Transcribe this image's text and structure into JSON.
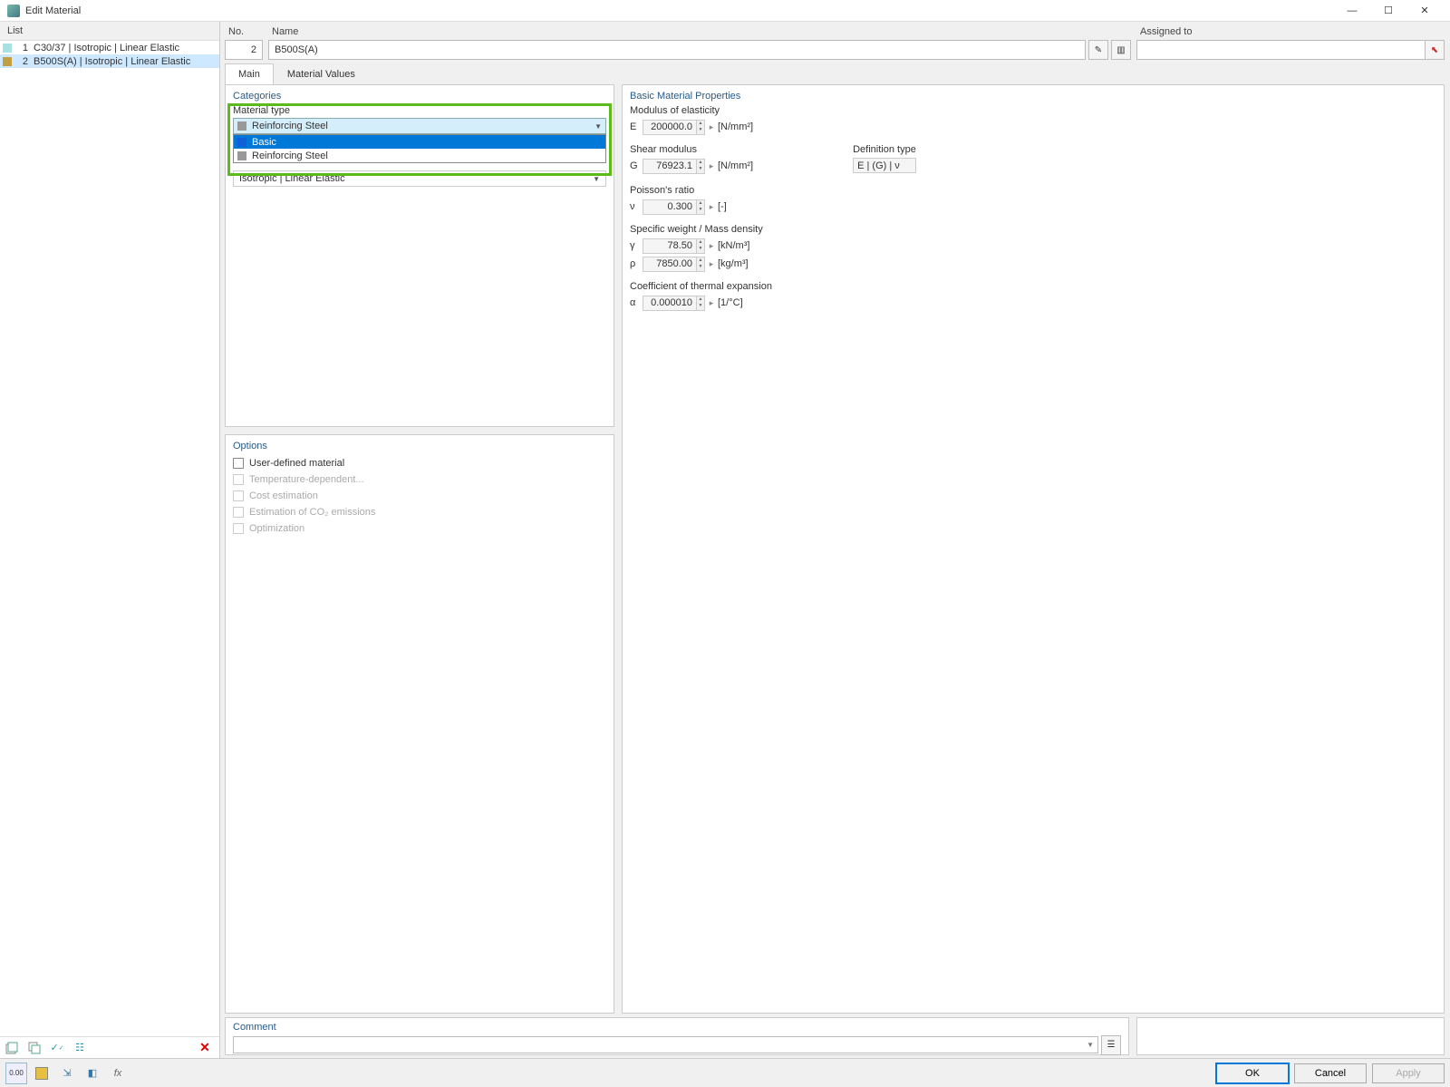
{
  "window": {
    "title": "Edit Material"
  },
  "list": {
    "header": "List",
    "items": [
      {
        "num": "1",
        "label": "C30/37 | Isotropic | Linear Elastic",
        "color": "#a7e2e2"
      },
      {
        "num": "2",
        "label": "B500S(A) | Isotropic | Linear Elastic",
        "color": "#c0a040"
      }
    ],
    "selected": 1
  },
  "top": {
    "no_label": "No.",
    "no_value": "2",
    "name_label": "Name",
    "name_value": "B500S(A)",
    "assigned_label": "Assigned to",
    "assigned_value": ""
  },
  "tabs": {
    "main": "Main",
    "values": "Material Values"
  },
  "categories": {
    "title": "Categories",
    "material_type_label": "Material type",
    "material_type_value": "Reinforcing Steel",
    "dropdown": [
      {
        "label": "Basic",
        "color": "#1060d8"
      },
      {
        "label": "Reinforcing Steel",
        "color": "#999"
      }
    ],
    "dropdown_selected": 0,
    "hidden_row": "Isotropic | Linear Elastic"
  },
  "options": {
    "title": "Options",
    "items": [
      {
        "label": "User-defined material",
        "enabled": true
      },
      {
        "label": "Temperature-dependent...",
        "enabled": false
      },
      {
        "label": "Cost estimation",
        "enabled": false
      },
      {
        "label": "Estimation of CO₂ emissions",
        "enabled": false
      },
      {
        "label": "Optimization",
        "enabled": false
      }
    ]
  },
  "props": {
    "title": "Basic Material Properties",
    "modulus_label": "Modulus of elasticity",
    "modulus_sym": "E",
    "modulus_val": "200000.0",
    "modulus_unit": "[N/mm²]",
    "shear_label": "Shear modulus",
    "shear_sym": "G",
    "shear_val": "76923.1",
    "shear_unit": "[N/mm²]",
    "def_type_label": "Definition type",
    "def_type_val": "E | (G) | ν",
    "poisson_label": "Poisson's ratio",
    "poisson_sym": "ν",
    "poisson_val": "0.300",
    "poisson_unit": "[-]",
    "weight_label": "Specific weight / Mass density",
    "weight_sym": "γ",
    "weight_val": "78.50",
    "weight_unit": "[kN/m³]",
    "density_sym": "ρ",
    "density_val": "7850.00",
    "density_unit": "[kg/m³]",
    "thermal_label": "Coefficient of thermal expansion",
    "thermal_sym": "α",
    "thermal_val": "0.000010",
    "thermal_unit": "[1/°C]"
  },
  "comment": {
    "label": "Comment"
  },
  "buttons": {
    "ok": "OK",
    "cancel": "Cancel",
    "apply": "Apply"
  }
}
